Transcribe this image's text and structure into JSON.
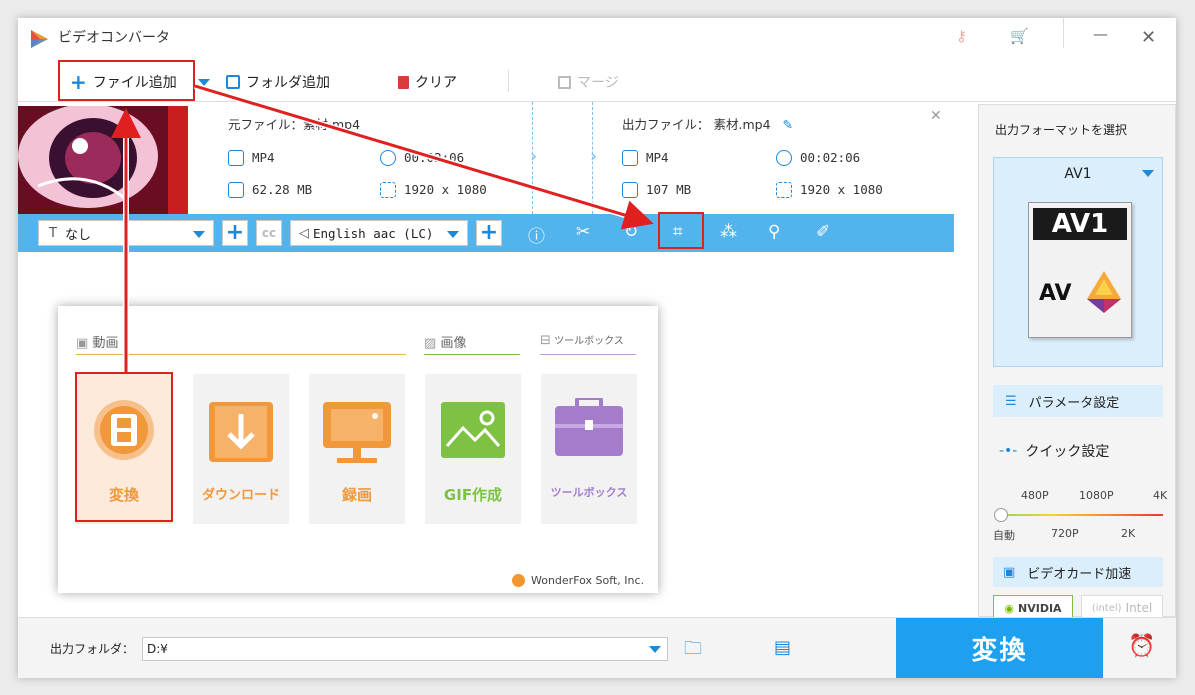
{
  "titlebar": {
    "title": "ビデオコンバータ"
  },
  "toolbar": {
    "add_file": "ファイル追加",
    "add_folder": "フォルダ追加",
    "clear": "クリア",
    "merge": "マージ"
  },
  "file": {
    "source_label": "元ファイル：",
    "source_name": "素材.mp4",
    "source_format": "MP4",
    "source_duration": "00:02:06",
    "source_size": "62.28 MB",
    "source_res": "1920 x 1080",
    "output_label": "出力ファイル：",
    "output_name": "素材.mp4",
    "output_format": "MP4",
    "output_duration": "00:02:06",
    "output_size": "107 MB",
    "output_res": "1920 x 1080"
  },
  "editbar": {
    "subtitle": "なし",
    "audio": "English aac (LC)"
  },
  "launcher": {
    "section_video": "動画",
    "section_image": "画像",
    "section_toolbox": "ツールボックス",
    "tiles": [
      "変換",
      "ダウンロード",
      "録画",
      "GIF作成",
      "ツールボックス"
    ],
    "footer": "WonderFox Soft, Inc."
  },
  "right": {
    "format_title": "出力フォーマットを選択",
    "format_name": "AV1",
    "format_logo_top": "AV1",
    "format_logo_bottom": "AV",
    "params": "パラメータ設定",
    "quick": "クイック設定",
    "ticks_top": [
      "480P",
      "1080P",
      "4K"
    ],
    "ticks_bottom": [
      "自動",
      "720P",
      "2K"
    ],
    "gpu": "ビデオカード加速",
    "nvidia": "NVIDIA",
    "intel": "Intel",
    "quality_level": 0
  },
  "bottom": {
    "folder_label": "出力フォルダ：",
    "folder_value": "D:¥",
    "convert": "変換"
  },
  "colors": {
    "accent": "#1ea0f0",
    "toolbar_bar": "#53b3ec",
    "annotation": "#e02020",
    "orange": "#f0983a",
    "green": "#7dc242",
    "purple": "#a57ccc"
  }
}
